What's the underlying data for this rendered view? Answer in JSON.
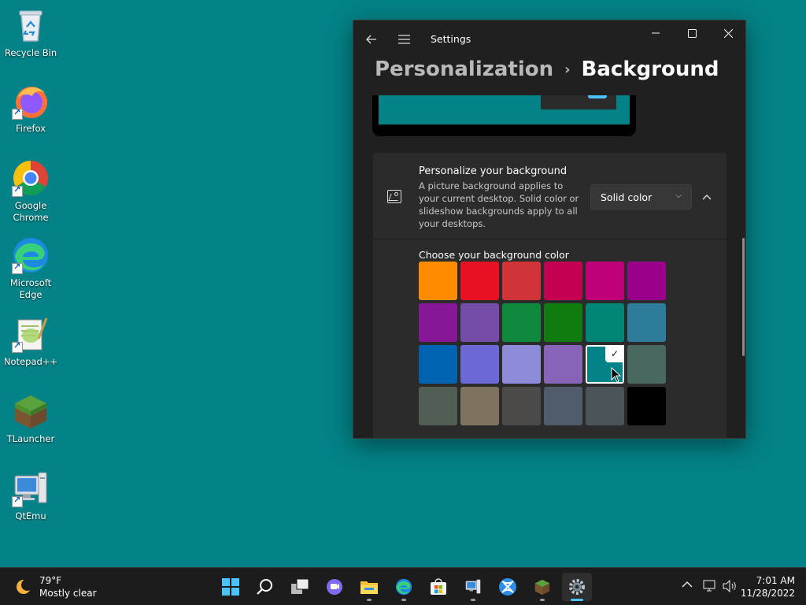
{
  "desktop": {
    "icons": [
      {
        "label": "Recycle Bin",
        "icon": "recycle-bin-icon"
      },
      {
        "label": "Firefox",
        "icon": "firefox-icon"
      },
      {
        "label": "Google Chrome",
        "icon": "chrome-icon"
      },
      {
        "label": "Microsoft Edge",
        "icon": "edge-icon"
      },
      {
        "label": "Notepad++",
        "icon": "notepad-plus-plus-icon"
      },
      {
        "label": "TLauncher",
        "icon": "tlauncher-icon"
      },
      {
        "label": "QtEmu",
        "icon": "qtemu-icon"
      }
    ],
    "wallpaper_color": "#038387"
  },
  "settings": {
    "app_title": "Settings",
    "breadcrumb": {
      "parent": "Personalization",
      "separator": "›",
      "current": "Background"
    },
    "personalize": {
      "title": "Personalize your background",
      "description": "A picture background applies to your current desktop. Solid color or slideshow backgrounds apply to all your desktops.",
      "dropdown_value": "Solid color"
    },
    "color_section": {
      "title": "Choose your background color",
      "swatches": [
        "#ff8c00",
        "#e81123",
        "#d13438",
        "#c30052",
        "#bf0077",
        "#9a0089",
        "#881798",
        "#744da9",
        "#10893e",
        "#107c10",
        "#018574",
        "#2d7d9a",
        "#0063b1",
        "#6b69d6",
        "#8e8cd8",
        "#8764b8",
        "#038387",
        "#486860",
        "#525e54",
        "#7e735f",
        "#4c4a48",
        "#515c6b",
        "#4a5459",
        "#000000"
      ],
      "selected_index": 16
    }
  },
  "taskbar": {
    "weather": {
      "temp": "79°F",
      "condition": "Mostly clear"
    },
    "apps": [
      "start-icon",
      "search-icon",
      "task-view-icon",
      "chat-icon",
      "file-explorer-icon",
      "edge-icon",
      "store-icon",
      "qtemu-icon",
      "xbox-icon",
      "tlauncher-icon",
      "settings-icon"
    ],
    "time": "7:01 AM",
    "date": "11/28/2022"
  }
}
